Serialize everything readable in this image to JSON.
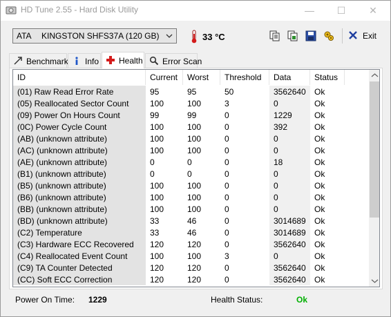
{
  "window": {
    "title": "HD Tune 2.55 - Hard Disk Utility"
  },
  "toolbar": {
    "drive_interface": "ATA",
    "drive_model": "KINGSTON SHFS37A (120 GB)",
    "temperature": "33 °C",
    "exit_label": "Exit",
    "icons": [
      "copy-text-icon",
      "copy-screenshot-icon",
      "save-icon",
      "options-icon",
      "exit-icon"
    ]
  },
  "tabs": [
    {
      "label": "Benchmark",
      "icon": "benchmark-icon",
      "active": false
    },
    {
      "label": "Info",
      "icon": "info-icon",
      "active": false
    },
    {
      "label": "Health",
      "icon": "health-icon",
      "active": true
    },
    {
      "label": "Error Scan",
      "icon": "error-scan-icon",
      "active": false
    }
  ],
  "health_table": {
    "columns": [
      "ID",
      "Current",
      "Worst",
      "Threshold",
      "Data",
      "Status"
    ],
    "rows": [
      [
        "(01) Raw Read Error Rate",
        "95",
        "95",
        "50",
        "3562640",
        "Ok"
      ],
      [
        "(05) Reallocated Sector Count",
        "100",
        "100",
        "3",
        "0",
        "Ok"
      ],
      [
        "(09) Power On Hours Count",
        "99",
        "99",
        "0",
        "1229",
        "Ok"
      ],
      [
        "(0C) Power Cycle Count",
        "100",
        "100",
        "0",
        "392",
        "Ok"
      ],
      [
        "(AB) (unknown attribute)",
        "100",
        "100",
        "0",
        "0",
        "Ok"
      ],
      [
        "(AC) (unknown attribute)",
        "100",
        "100",
        "0",
        "0",
        "Ok"
      ],
      [
        "(AE) (unknown attribute)",
        "0",
        "0",
        "0",
        "18",
        "Ok"
      ],
      [
        "(B1) (unknown attribute)",
        "0",
        "0",
        "0",
        "0",
        "Ok"
      ],
      [
        "(B5) (unknown attribute)",
        "100",
        "100",
        "0",
        "0",
        "Ok"
      ],
      [
        "(B6) (unknown attribute)",
        "100",
        "100",
        "0",
        "0",
        "Ok"
      ],
      [
        "(BB) (unknown attribute)",
        "100",
        "100",
        "0",
        "0",
        "Ok"
      ],
      [
        "(BD) (unknown attribute)",
        "33",
        "46",
        "0",
        "3014689",
        "Ok"
      ],
      [
        "(C2) Temperature",
        "33",
        "46",
        "0",
        "3014689",
        "Ok"
      ],
      [
        "(C3) Hardware ECC Recovered",
        "120",
        "120",
        "0",
        "3562640",
        "Ok"
      ],
      [
        "(C4) Reallocated Event Count",
        "100",
        "100",
        "3",
        "0",
        "Ok"
      ],
      [
        "(C9) TA Counter Detected",
        "120",
        "120",
        "0",
        "3562640",
        "Ok"
      ],
      [
        "(CC) Soft ECC Correction",
        "120",
        "120",
        "0",
        "3562640",
        "Ok"
      ]
    ]
  },
  "status_bar": {
    "power_on_label": "Power On Time:",
    "power_on_value": "1229",
    "health_label": "Health Status:",
    "health_value": "Ok",
    "health_color": "#00b000"
  }
}
